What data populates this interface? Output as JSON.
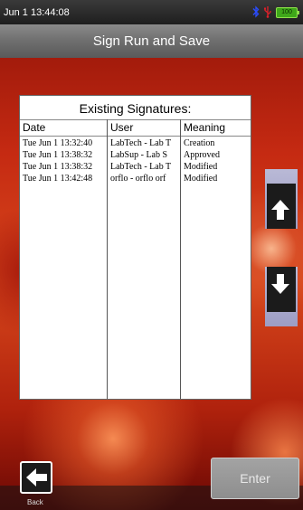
{
  "statusbar": {
    "time": "Jun  1 13:44:08",
    "battery_label": "100"
  },
  "header": {
    "title": "Sign Run and Save"
  },
  "signatures": {
    "title": "Existing Signatures:",
    "columns": [
      "Date",
      "User",
      "Meaning"
    ],
    "rows": [
      {
        "date": "Tue Jun  1 13:32:40",
        "user": "LabTech - Lab T",
        "meaning": "Creation"
      },
      {
        "date": "Tue Jun  1 13:38:32",
        "user": "LabSup - Lab S",
        "meaning": "Approved"
      },
      {
        "date": "Tue Jun  1 13:38:32",
        "user": "LabTech - Lab T",
        "meaning": "Modified"
      },
      {
        "date": "Tue Jun  1 13:42:48",
        "user": "orflo - orflo orf",
        "meaning": "Modified"
      }
    ]
  },
  "footer": {
    "back_label": "Back",
    "enter_label": "Enter"
  },
  "icons": {
    "bluetooth": "bluetooth-icon",
    "usb": "usb-icon",
    "battery": "battery-icon",
    "scroll_up": "arrow-up-icon",
    "scroll_down": "arrow-down-icon",
    "back": "arrow-left-icon"
  },
  "colors": {
    "bluetooth": "#2a4cff",
    "usb": "#e0202a",
    "battery": "#3fa81a"
  }
}
